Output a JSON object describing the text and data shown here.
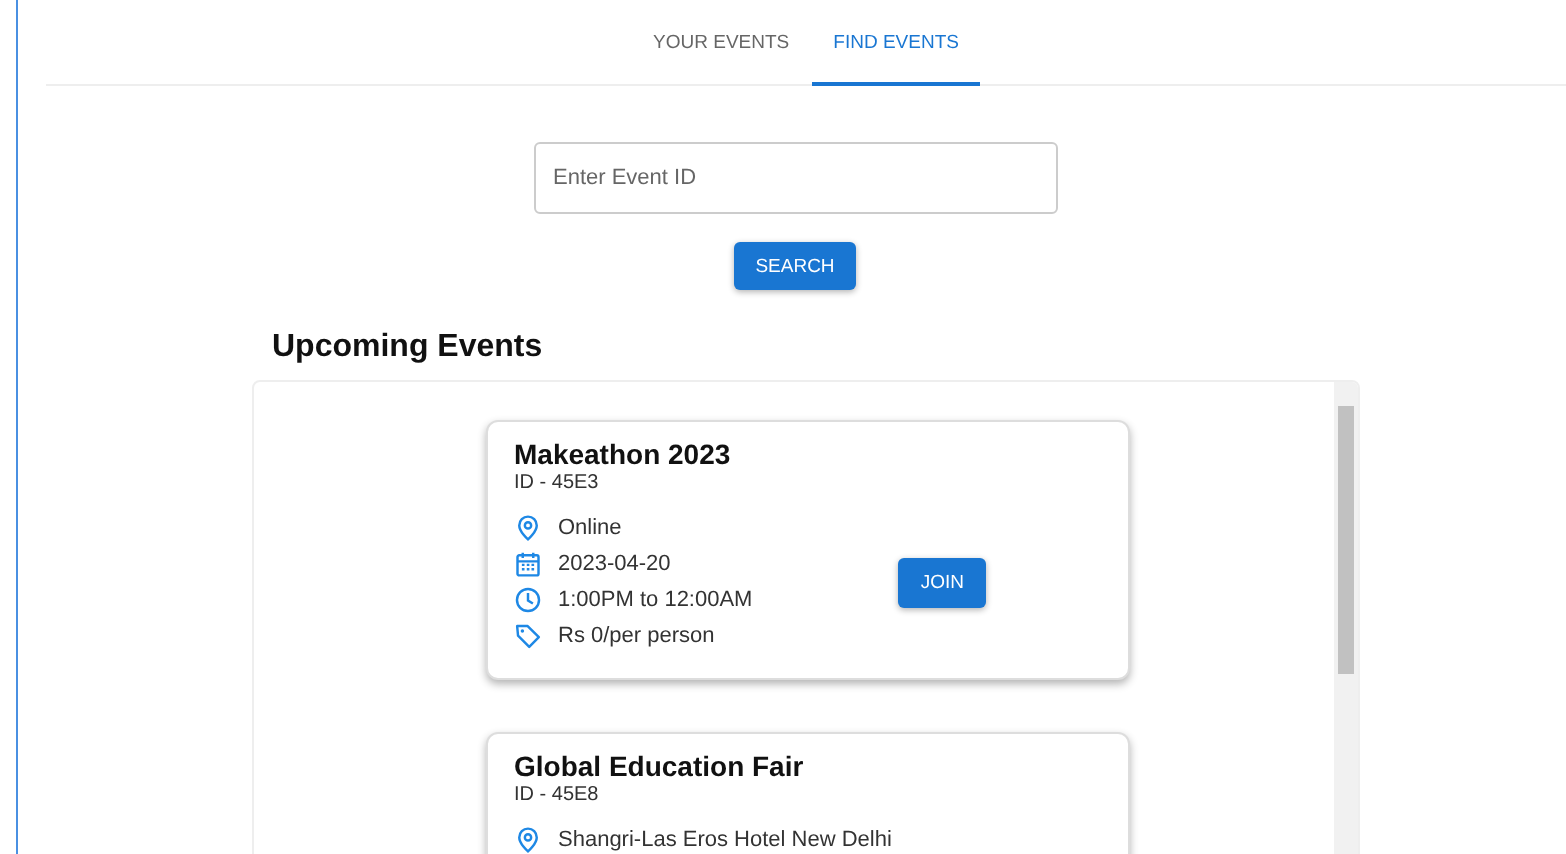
{
  "tabs": [
    {
      "label": "YOUR EVENTS",
      "selected": false
    },
    {
      "label": "FIND EVENTS",
      "selected": true
    }
  ],
  "search": {
    "placeholder": "Enter Event ID",
    "button": "SEARCH"
  },
  "section_title": "Upcoming Events",
  "events": [
    {
      "title": "Makeathon 2023",
      "id": "ID - 45E3",
      "details": [
        {
          "kind": "location",
          "text": "Online"
        },
        {
          "kind": "date",
          "text": "2023-04-20"
        },
        {
          "kind": "time",
          "text": "1:00PM to 12:00AM"
        },
        {
          "kind": "price",
          "text": "Rs 0/per person"
        }
      ],
      "button": "JOIN"
    },
    {
      "title": "Global Education Fair",
      "id": "ID - 45E8",
      "details": [
        {
          "kind": "location",
          "text": "Shangri-Las Eros Hotel New Delhi"
        }
      ]
    }
  ]
}
